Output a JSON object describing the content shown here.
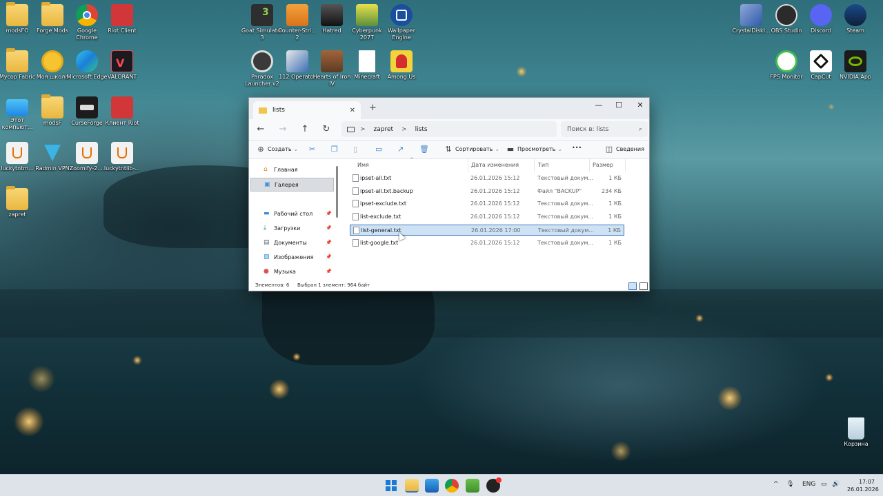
{
  "desktop": {
    "icons": [
      {
        "label": "modsFO"
      },
      {
        "label": "Forge Mods"
      },
      {
        "label": "Google Chrome"
      },
      {
        "label": "Riot Client"
      },
      {
        "label": "Мусор Fabric"
      },
      {
        "label": "Моя школа"
      },
      {
        "label": "Microsoft Edge"
      },
      {
        "label": "VALORANT"
      },
      {
        "label": "Этот компьют..."
      },
      {
        "label": "modsF"
      },
      {
        "label": "CurseForge"
      },
      {
        "label": "Клиент Riot"
      },
      {
        "label": "luckytntm..."
      },
      {
        "label": "Radmin VPN"
      },
      {
        "label": "Zoomify-2...."
      },
      {
        "label": "luckytntlib-..."
      },
      {
        "label": "zapret"
      },
      {
        "label": "Goat Simulator 3"
      },
      {
        "label": "Counter-Stri... 2"
      },
      {
        "label": "Hatred"
      },
      {
        "label": "Cyberpunk 2077"
      },
      {
        "label": "Wallpaper Engine"
      },
      {
        "label": "Paradox Launcher v2"
      },
      {
        "label": "112 Operator"
      },
      {
        "label": "Hearts of Iron IV"
      },
      {
        "label": "Minecraft"
      },
      {
        "label": "Among Us"
      },
      {
        "label": "CrystalDiskI..."
      },
      {
        "label": "OBS Studio"
      },
      {
        "label": "Discord"
      },
      {
        "label": "Steam"
      },
      {
        "label": "FPS Monitor"
      },
      {
        "label": "CapCut"
      },
      {
        "label": "NVIDIA App"
      },
      {
        "label": "Корзина"
      }
    ]
  },
  "explorer": {
    "tab_title": "lists",
    "tab_close": "✕",
    "new_tab": "+",
    "controls": {
      "minimize": "—",
      "maximize": "☐",
      "close": "✕"
    },
    "nav": {
      "back": "←",
      "forward": "→",
      "up": "↑",
      "refresh": "↻"
    },
    "breadcrumb": [
      "zapret",
      "lists"
    ],
    "breadcrumb_sep": ">",
    "search_placeholder": "Поиск в: lists",
    "toolbar": {
      "create": "Создать",
      "sort": "Сортировать",
      "view": "Просмотреть",
      "more": "•••",
      "details": "Сведения"
    },
    "nav_pane": [
      {
        "label": "Главная",
        "icon": "home-icon",
        "glyph": "⌂"
      },
      {
        "label": "Галерея",
        "icon": "gallery-icon",
        "glyph": "▣"
      },
      {
        "label": "Рабочий стол",
        "icon": "desktop-icon",
        "glyph": "▬"
      },
      {
        "label": "Загрузки",
        "icon": "download-icon",
        "glyph": "⤓"
      },
      {
        "label": "Документы",
        "icon": "documents-icon",
        "glyph": "▤"
      },
      {
        "label": "Изображения",
        "icon": "pictures-icon",
        "glyph": "▨"
      },
      {
        "label": "Музыка",
        "icon": "music-icon",
        "glyph": "●"
      }
    ],
    "columns": {
      "name": "Имя",
      "date": "Дата изменения",
      "type": "Тип",
      "size": "Размер"
    },
    "files": [
      {
        "name": "ipset-all.txt",
        "date": "26.01.2026 15:12",
        "type": "Текстовый докум...",
        "size": "1 КБ"
      },
      {
        "name": "ipset-all.txt.backup",
        "date": "26.01.2026 15:12",
        "type": "Файл \"BACKUP\"",
        "size": "234 КБ"
      },
      {
        "name": "ipset-exclude.txt",
        "date": "26.01.2026 15:12",
        "type": "Текстовый докум...",
        "size": "1 КБ"
      },
      {
        "name": "list-exclude.txt",
        "date": "26.01.2026 15:12",
        "type": "Текстовый докум...",
        "size": "1 КБ"
      },
      {
        "name": "list-general.txt",
        "date": "26.01.2026 17:00",
        "type": "Текстовый докум...",
        "size": "1 КБ"
      },
      {
        "name": "list-google.txt",
        "date": "26.01.2026 15:12",
        "type": "Текстовый докум...",
        "size": "1 КБ"
      }
    ],
    "selected_index": 4,
    "status": {
      "count": "Элементов: 6",
      "selection": "Выбран 1 элемент: 964 байт"
    }
  },
  "taskbar": {
    "tray": {
      "chevron": "^",
      "mic": "🎙",
      "lang": "ENG",
      "net": "▭",
      "volume": "🔊"
    },
    "clock_time": "17:07",
    "clock_date": "26.01.2026"
  },
  "colors": {
    "accent": "#3a74b8",
    "selection": "#cde3f5",
    "folder": "#f1c54e"
  }
}
